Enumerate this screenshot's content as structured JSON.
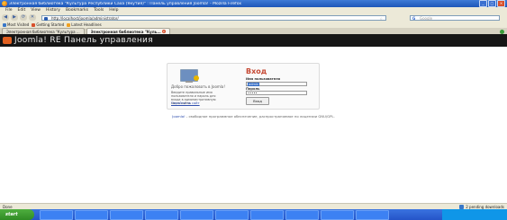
{
  "window": {
    "title": "Электронная библиотека \"Культура Республики Саха (Якутия)\" : Панель управления Joomla! - Mozilla Firefox",
    "min": "_",
    "max": "□",
    "close": "×"
  },
  "menu": [
    "File",
    "Edit",
    "View",
    "History",
    "Bookmarks",
    "Tools",
    "Help"
  ],
  "nav": {
    "back": "◀",
    "forward": "▶",
    "reload": "⟳",
    "stop": "✕",
    "home": "⌂",
    "url": "http://localhost/joomla/administrator/",
    "search_engine_icon": "G",
    "search_placeholder": "Google"
  },
  "bookmarks": [
    {
      "label": "Most Visited",
      "color": "#3a78c8"
    },
    {
      "label": "Getting Started",
      "color": "#d8502c"
    },
    {
      "label": "Latest Headlines",
      "color": "#f0a020"
    }
  ],
  "tabs": [
    {
      "label": "Электронная библиотека \"Культура ...",
      "active": false
    },
    {
      "label": "Электронная библиотека \"Куль...",
      "active": true
    }
  ],
  "header": {
    "title": "Joomla! RE  Панель управления"
  },
  "login": {
    "heading": "Вход",
    "welcome": "Добро пожаловать в Joomla!",
    "help": "Введите правильные имя пользователя и пароль для входа в административную часть сайта.",
    "site_link": "Перейти на сайт",
    "username_label": "Имя пользователя",
    "username_value": "admin",
    "password_label": "Пароль",
    "password_value": "•••••",
    "submit": "Вход"
  },
  "footer": {
    "joomla_link": "Joomla!",
    "text": " - свободное программное обеспечение, распространяемое по лицензии GNU/GPL."
  },
  "status": {
    "left": "Done",
    "right": "2 pending downloads"
  },
  "taskbar": {
    "start": "start"
  }
}
